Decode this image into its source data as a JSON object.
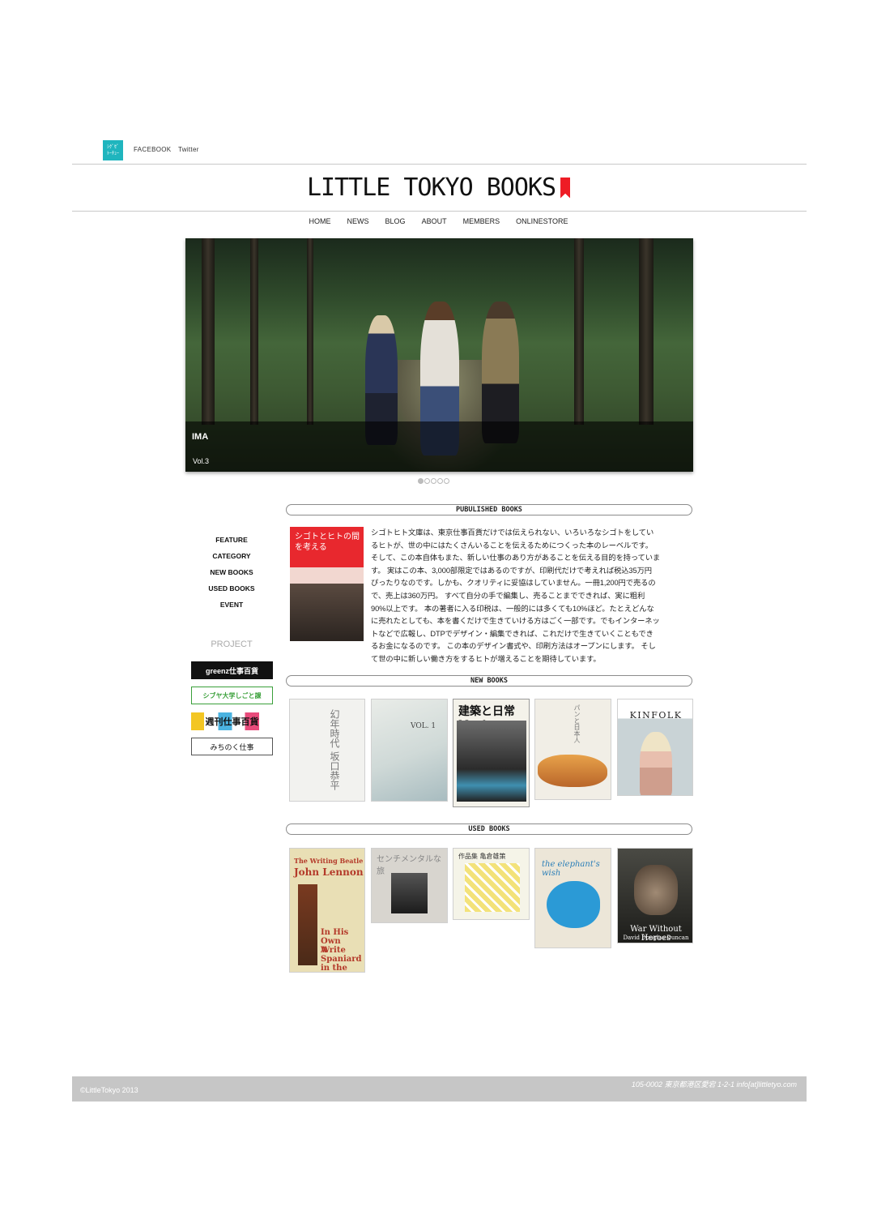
{
  "topbar": {
    "logo_line1": "ｼｸﾞｾﾞ",
    "logo_line2": "ﾄｰﾁｭｰ",
    "facebook": "FACEBOOK",
    "twitter": "Twitter"
  },
  "site": {
    "title": "LITTLE TOKYO BOOKS",
    "accent_color": "#ee1c25"
  },
  "nav": [
    "HOME",
    "NEWS",
    "BLOG",
    "ABOUT",
    "MEMBERS",
    "ONLINESTORE"
  ],
  "hero": {
    "title": "IMA",
    "subtitle": "Vol.3",
    "slides": 5,
    "active_slide": 1
  },
  "sidebar": {
    "links": [
      "FEATURE",
      "CATEGORY",
      "NEW BOOKS",
      "USED BOOKS",
      "EVENT"
    ],
    "project_label": "PROJECT",
    "banners": [
      "greenz仕事百貨",
      "シブヤ大学しごと課",
      "週刊仕事百貨",
      "みちのく仕事"
    ]
  },
  "published": {
    "header": "PUBULISHED BOOKS",
    "cover_title": "シゴトとヒトの間を考える",
    "lines": [
      "シゴトヒト文庫は、東京仕事百貨だけでは伝えられない、いろいろなシゴトをしてい",
      "るヒトが、世の中にはたくさんいることを伝えるためにつくった本のレーベルです。",
      "そして、この本自体もまた、新しい仕事のあり方があることを伝える目的を持っていま",
      "す。 実はこの本、3,000部限定ではあるのですが、印刷代だけで考えれば税込35万円",
      "ぴったりなのです。しかも、クオリティに妥協はしていません。一冊1,200円で売るの",
      "で、売上は360万円。 すべて自分の手で編集し、売ることまでできれば、実に粗利",
      "90%以上です。 本の著者に入る印税は、一般的には多くても10%ほど。たとえどんな",
      "に売れたとしても、本を書くだけで生きていける方はごく一部です。でもインターネッ",
      "トなどで広報し、DTPでデザイン・編集できれば、これだけで生きていくこともでき",
      "るお金になるのです。 この本のデザイン書式や、印刷方法はオープンにします。 そし",
      "て世の中に新しい働き方をするヒトが増えることを期待しています。"
    ]
  },
  "new_books": {
    "header": "NEW BOOKS",
    "books": [
      {
        "text": "幻年時代 坂口恭平"
      },
      {
        "text": "VOL. 1"
      },
      {
        "text": "建築と日常 No.1"
      },
      {
        "text": "パンと日本人"
      },
      {
        "text": "KINFOLK"
      }
    ]
  },
  "used_books": {
    "header": "USED BOOKS",
    "books": [
      {
        "line1": "The Writing Beatle",
        "line2": "John Lennon",
        "line3": "In His Own Write",
        "line4": "A Spaniard in the Works"
      },
      {
        "line1": "センチメンタルな旅"
      },
      {
        "line1": "作品集 亀倉雄策"
      },
      {
        "line1": "the elephant's wish"
      },
      {
        "line1": "War Without Heroes",
        "line2": "David Douglas Duncan"
      }
    ]
  },
  "footer": {
    "copyright": "©LittleTokyo 2013",
    "address": "105-0002 東京都港区愛宕 1-2-1 info[at]littletyo.com"
  }
}
